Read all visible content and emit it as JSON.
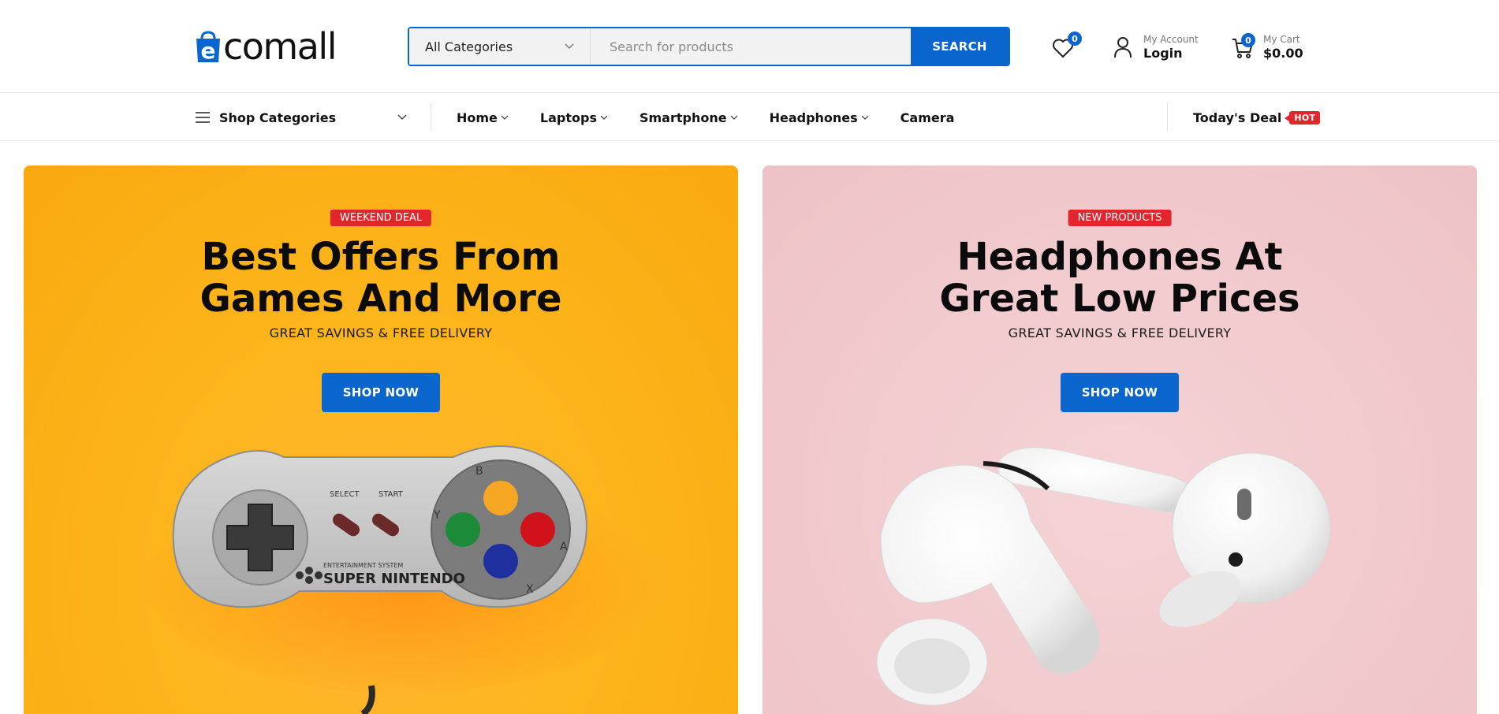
{
  "brand": {
    "logo_text": "comall",
    "logo_letter": "e",
    "accent": "#0a66cc",
    "hot_red": "#e2262d"
  },
  "search": {
    "category_selected": "All Categories",
    "placeholder": "Search for products",
    "value": "",
    "button_label": "SEARCH"
  },
  "header": {
    "wishlist": {
      "icon": "heart-icon",
      "count": "0"
    },
    "account": {
      "icon": "user-icon",
      "small_label": "My Account",
      "big_label": "Login"
    },
    "cart": {
      "icon": "cart-icon",
      "count": "0",
      "small_label": "My Cart",
      "total": "$0.00"
    }
  },
  "nav": {
    "shop_categories": "Shop Categories",
    "menu": [
      {
        "label": "Home",
        "has_dropdown": true
      },
      {
        "label": "Laptops",
        "has_dropdown": true
      },
      {
        "label": "Smartphone",
        "has_dropdown": true
      },
      {
        "label": "Headphones",
        "has_dropdown": true
      },
      {
        "label": "Camera",
        "has_dropdown": false
      }
    ],
    "deal_label": "Today's Deal",
    "deal_badge": "HOT"
  },
  "banners": [
    {
      "tag": "WEEKEND DEAL",
      "title_line1": "Best Offers From",
      "title_line2": "Games And More",
      "subtitle": "GREAT SAVINGS & FREE DELIVERY",
      "button": "SHOP NOW",
      "background": "#fdb51c",
      "art": "game-controller-image",
      "controller_text": {
        "select": "SELECT",
        "start": "START",
        "brand": "SUPER NINTENDO",
        "brand_small": "ENTERTAINMENT SYSTEM",
        "keys": [
          "B",
          "Y",
          "A",
          "X"
        ]
      }
    },
    {
      "tag": "NEW PRODUCTS",
      "title_line1": "Headphones At",
      "title_line2": "Great Low Prices",
      "subtitle": "GREAT SAVINGS & FREE DELIVERY",
      "button": "SHOP NOW",
      "background": "#f1cacd",
      "art": "earbuds-image"
    }
  ]
}
